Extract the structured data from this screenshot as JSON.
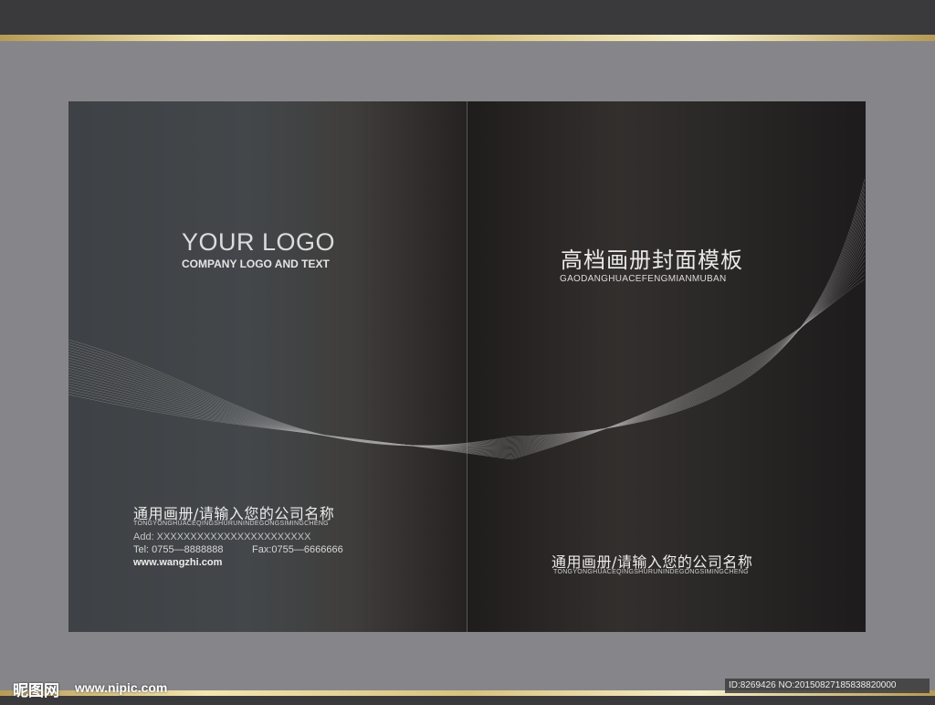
{
  "left_cover": {
    "logo_title": "YOUR LOGO",
    "logo_subtitle": "COMPANY LOGO AND TEXT",
    "company_name": "通用画册/请输入您的公司名称",
    "company_pinyin": "TONGYONGHUACEQINGSHURUNINDEGONGSIMINGCHENG",
    "address": "Add: XXXXXXXXXXXXXXXXXXXXXXX",
    "tel": "Tel: 0755—8888888",
    "fax": "Fax:0755—6666666",
    "website": "www.wangzhi.com"
  },
  "right_cover": {
    "title": "高档画册封面模板",
    "title_pinyin": "GAODANGHUACEFENGMIANMUBAN",
    "company_name": "通用画册/请输入您的公司名称",
    "company_pinyin": "TONGYONGHUACEQINGSHURUNINDEGONGSIMINGCHENG"
  },
  "watermark": {
    "site_name": "昵图网",
    "site_url": "www.nipic.com",
    "id_text": "ID:8269426 NO:20150827185838820000"
  },
  "colors": {
    "background": "#86868a",
    "gold": "#d8c27f",
    "cover_dark": "#2b2928",
    "line": "#9a9a9a"
  }
}
